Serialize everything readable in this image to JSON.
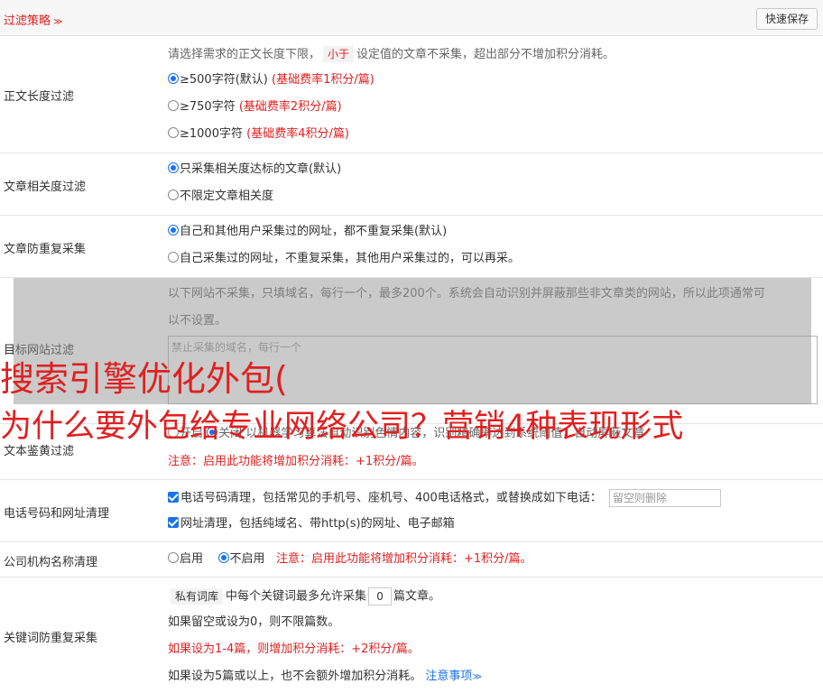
{
  "header": {
    "title": "过滤策略",
    "chevron": "≫",
    "save_label": "快速保存"
  },
  "length_filter": {
    "label": "正文长度过滤",
    "intro_prefix": "请选择需求的正文长度下限，",
    "intro_tag": "小于",
    "intro_suffix": "设定值的文章不采集，超出部分不增加积分消耗。",
    "options": [
      {
        "text": "≥500字符(默认)",
        "note": "(基础费率1积分/篇)",
        "selected": true
      },
      {
        "text": "≥750字符",
        "note": "(基础费率2积分/篇)",
        "selected": false
      },
      {
        "text": "≥1000字符",
        "note": "(基础费率4积分/篇)",
        "selected": false
      }
    ]
  },
  "relevance": {
    "label": "文章相关度过滤",
    "options": [
      {
        "text": "只采集相关度达标的文章(默认)",
        "selected": true
      },
      {
        "text": "不限定文章相关度",
        "selected": false
      }
    ]
  },
  "dedupe": {
    "label": "文章防重复采集",
    "options": [
      {
        "text": "自己和其他用户采集过的网址，都不重复采集(默认)",
        "selected": true
      },
      {
        "text": "自己采集过的网址，不重复采集，其他用户采集过的，可以再采。",
        "selected": false
      }
    ]
  },
  "site_filter": {
    "label": "目标网站过滤",
    "intro_line1": "以下网站不采集，只填域名，每行一个，最多200个。系统会自动识别并屏蔽那些非文章类的网站，所以此项通常可",
    "intro_line2": "以不设置。",
    "placeholder": "禁止采集的域名，每行一个"
  },
  "porn_filter": {
    "label": "文本鉴黄过滤",
    "option_on": "开启",
    "option_off": "关闭",
    "option_off_selected": true,
    "desc": "以机器学习算法自动识别色情内容，识别精确率达到系统阈值，自动屏蔽文章",
    "note": "注意：启用此功能将增加积分消耗：+1积分/篇。"
  },
  "phone_url": {
    "label": "电话号码和网址清理",
    "phone_text": "电话号码清理，包括常见的手机号、座机号、400电话格式，或替换成如下电话：",
    "phone_placeholder": "留空则删除",
    "url_text": "网址清理，包括纯域名、带http(s)的网址、电子邮箱"
  },
  "org_name": {
    "label": "公司机构名称清理",
    "option_on": "启用",
    "option_off": "不启用",
    "note": "注意：启用此功能将增加积分消耗：+1积分/篇。"
  },
  "keyword_dedupe": {
    "label": "关键词防重复采集",
    "tag": "私有词库",
    "line1_mid": "中每个关键词最多允许采集",
    "value": "0",
    "line1_suffix": "篇文章。",
    "line2": "如果留空或设为0，则不限篇数。",
    "line3": "如果设为1-4篇，则增加积分消耗：+2积分/篇。",
    "line4": "如果设为5篇或以上，也不会额外增加积分消耗。",
    "help_link": "注意事项",
    "help_chevron": "≫"
  },
  "overlay": {
    "line1": "搜索引擎优化外包(",
    "line2": "为什么要外包给专业网络公司？营销4种表现形式"
  }
}
